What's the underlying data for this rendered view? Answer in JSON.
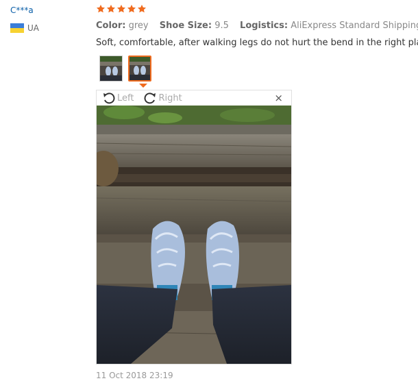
{
  "reviewer": {
    "name": "C***a",
    "country": "UA",
    "flag_colors": [
      "#3a7dd8",
      "#f7d232"
    ]
  },
  "rating": {
    "stars": 5,
    "max": 5,
    "color": "#f06b1e"
  },
  "attributes": {
    "color_label": "Color:",
    "color_value": "grey",
    "size_label": "Shoe Size:",
    "size_value": "9.5",
    "logistics_label": "Logistics:",
    "logistics_value": "AliExpress Standard Shipping"
  },
  "review_text": "Soft, comfortable, after walking legs do not hurt the bend in the right place.",
  "viewer": {
    "rotate_left": "Left",
    "rotate_right": "Right",
    "close_glyph": "×"
  },
  "date": "11 Oct 2018 23:19",
  "accent_color": "#f06b1e"
}
